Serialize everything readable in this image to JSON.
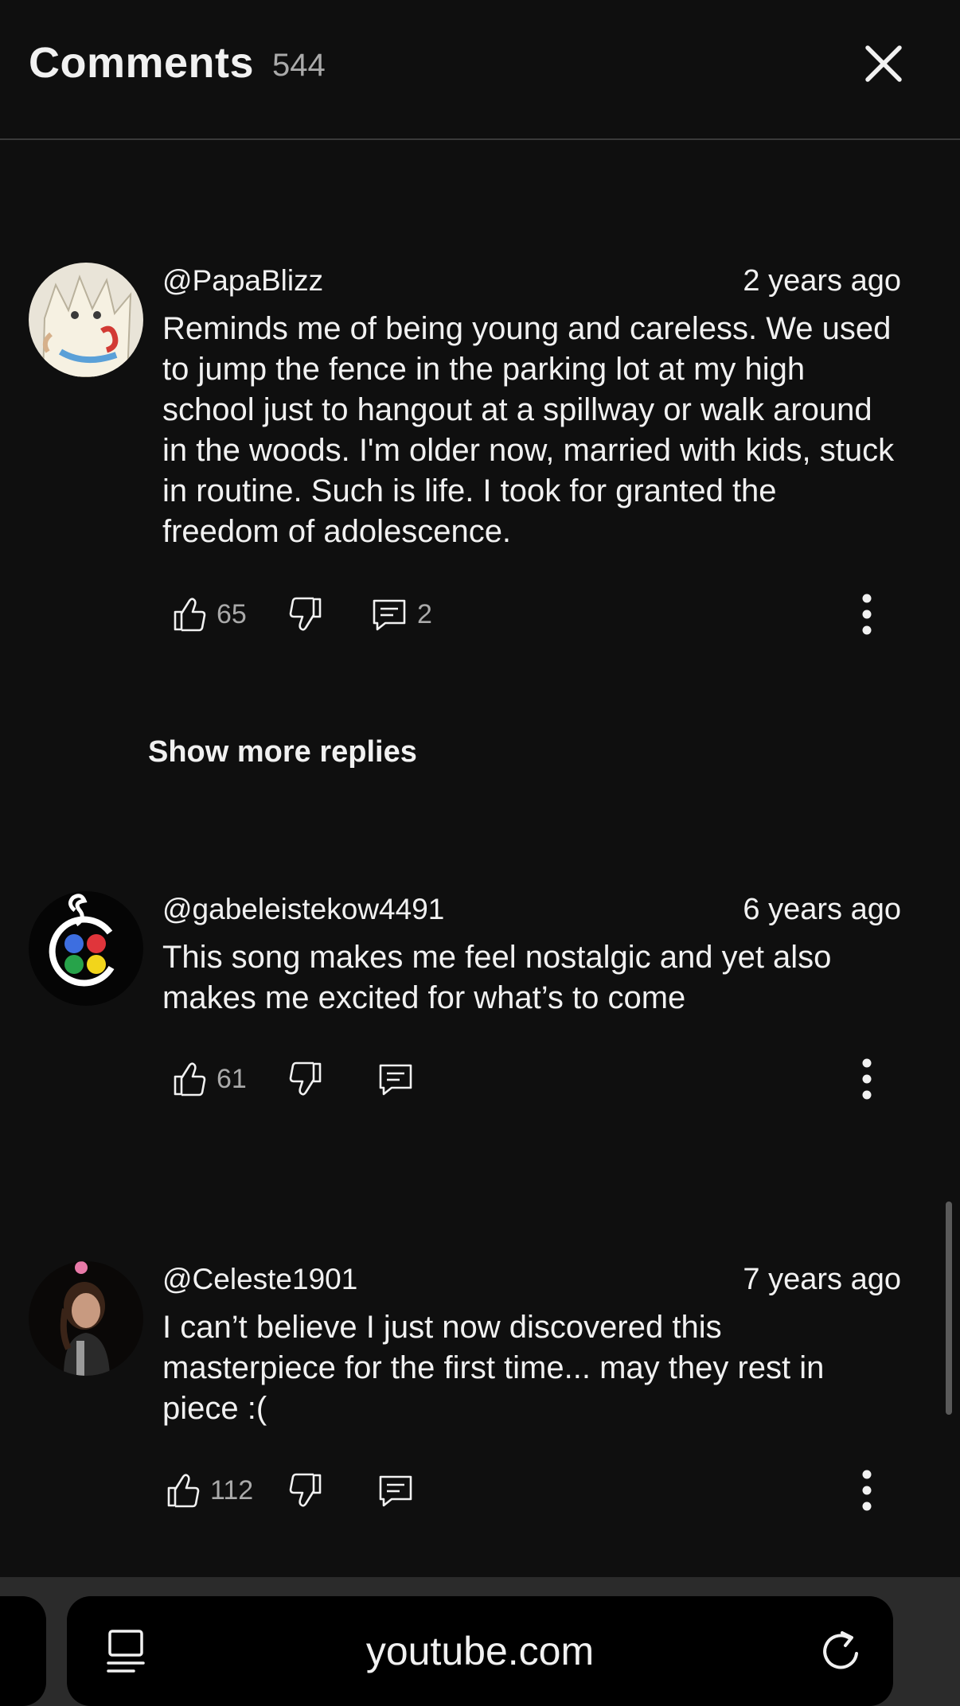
{
  "header": {
    "title": "Comments",
    "count": "544"
  },
  "comments": [
    {
      "author": "@PapaBlizz",
      "time": "2 years ago",
      "text": "Reminds me of being young and careless. We used to jump the fence in the parking lot at my high school just to hangout at a spillway or walk around in the woods. I'm older now, married with kids, stuck in routine. Such is life. I took for granted the freedom of adolescence.",
      "likes": "65",
      "replies": "2",
      "avatar_icon": "egg-creature-avatar"
    },
    {
      "author": "@gabeleistekow4491",
      "time": "6 years ago",
      "text": "This song makes me feel nostalgic and yet also makes me excited for what’s to come",
      "likes": "61",
      "replies": "",
      "avatar_icon": "four-color-dots-avatar"
    },
    {
      "author": "@Celeste1901",
      "time": "7 years ago",
      "text": "I can’t believe I just now discovered this masterpiece for the first time... may they rest in piece :(",
      "likes": "112",
      "replies": "",
      "avatar_icon": "person-photo-avatar"
    }
  ],
  "show_more_replies": "Show more replies",
  "browser": {
    "url": "youtube.com"
  },
  "icons": {
    "close": "close-icon",
    "like": "thumbs-up-icon",
    "dislike": "thumbs-down-icon",
    "reply": "reply-icon",
    "more": "more-vertical-icon",
    "tabs": "tabs-icon",
    "reload": "reload-icon"
  },
  "colors": {
    "background": "#0f0f0f",
    "text": "#f1f1f1",
    "secondary_text": "#aaaaaa",
    "bottom_bar": "#2b2b2b"
  }
}
